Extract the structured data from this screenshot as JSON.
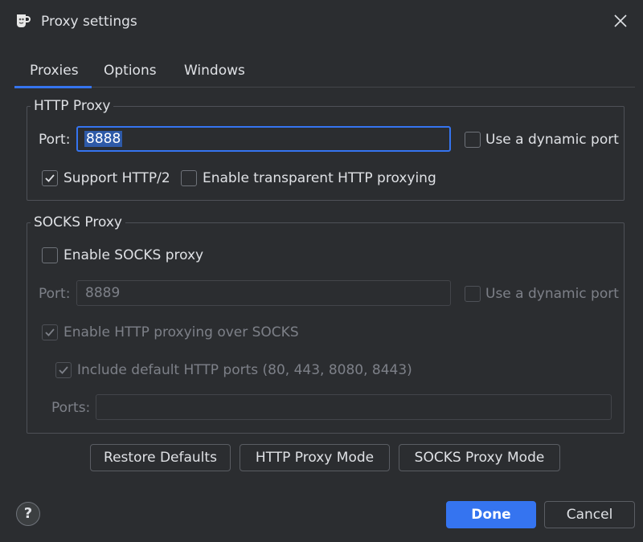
{
  "window": {
    "title": "Proxy settings"
  },
  "tabs": [
    {
      "label": "Proxies",
      "active": true
    },
    {
      "label": "Options",
      "active": false
    },
    {
      "label": "Windows",
      "active": false
    }
  ],
  "http_proxy": {
    "legend": "HTTP Proxy",
    "port_label": "Port:",
    "port_value": "8888",
    "dynamic_port_label": "Use a dynamic port",
    "dynamic_port_checked": false,
    "http2_label": "Support HTTP/2",
    "http2_checked": true,
    "transparent_label": "Enable transparent HTTP proxying",
    "transparent_checked": false
  },
  "socks_proxy": {
    "legend": "SOCKS Proxy",
    "enable_label": "Enable SOCKS proxy",
    "enable_checked": false,
    "port_label": "Port:",
    "port_value": "8889",
    "dynamic_port_label": "Use a dynamic port",
    "dynamic_port_checked": false,
    "http_over_socks_label": "Enable HTTP proxying over SOCKS",
    "http_over_socks_checked": true,
    "include_default_label": "Include default HTTP ports (80, 443, 8080, 8443)",
    "include_default_checked": true,
    "ports_label": "Ports:",
    "ports_value": ""
  },
  "actions": {
    "restore_defaults": "Restore Defaults",
    "http_proxy_mode": "HTTP Proxy Mode",
    "socks_proxy_mode": "SOCKS Proxy Mode"
  },
  "footer": {
    "help": "?",
    "done": "Done",
    "cancel": "Cancel"
  },
  "colors": {
    "background": "#2b2d30",
    "accent": "#3574f0",
    "text": "#dfe1e5",
    "disabled_text": "#7d8088"
  }
}
